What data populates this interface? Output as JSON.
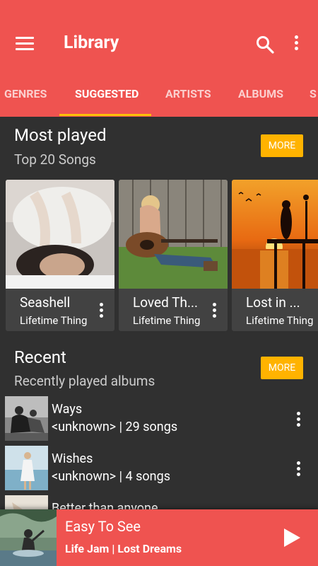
{
  "header": {
    "title": "Library",
    "tabs": [
      {
        "label": "GENRES"
      },
      {
        "label": "SUGGESTED"
      },
      {
        "label": "ARTISTS"
      },
      {
        "label": "ALBUMS"
      },
      {
        "label": "S"
      }
    ],
    "active_tab": "SUGGESTED",
    "icons": [
      "menu-icon",
      "search-icon",
      "more-vert-icon"
    ]
  },
  "most_played": {
    "title": "Most played",
    "subtitle": "Top 20 Songs",
    "more_label": "MORE",
    "cards": [
      {
        "title": "Seashell",
        "artist": "Lifetime Thing"
      },
      {
        "title": "Loved Th...",
        "artist": "Lifetime Thing"
      },
      {
        "title": "Lost in ...",
        "artist": "Lifetime Thing"
      }
    ]
  },
  "recent": {
    "title": "Recent",
    "subtitle": "Recently played albums",
    "more_label": "MORE",
    "items": [
      {
        "title": "Ways",
        "subtitle": "<unknown> | 29 songs"
      },
      {
        "title": "Wishes",
        "subtitle": "<unknown> | 4 songs"
      },
      {
        "title": "Better than anyone",
        "subtitle": ""
      }
    ]
  },
  "now_playing": {
    "title": "Easy To See",
    "subtitle": "Life Jam | Lost Dreams"
  },
  "colors": {
    "primary": "#ef5350",
    "accent": "#ffb300",
    "indicator": "#ffc107",
    "background": "#303030",
    "card": "#424242"
  }
}
